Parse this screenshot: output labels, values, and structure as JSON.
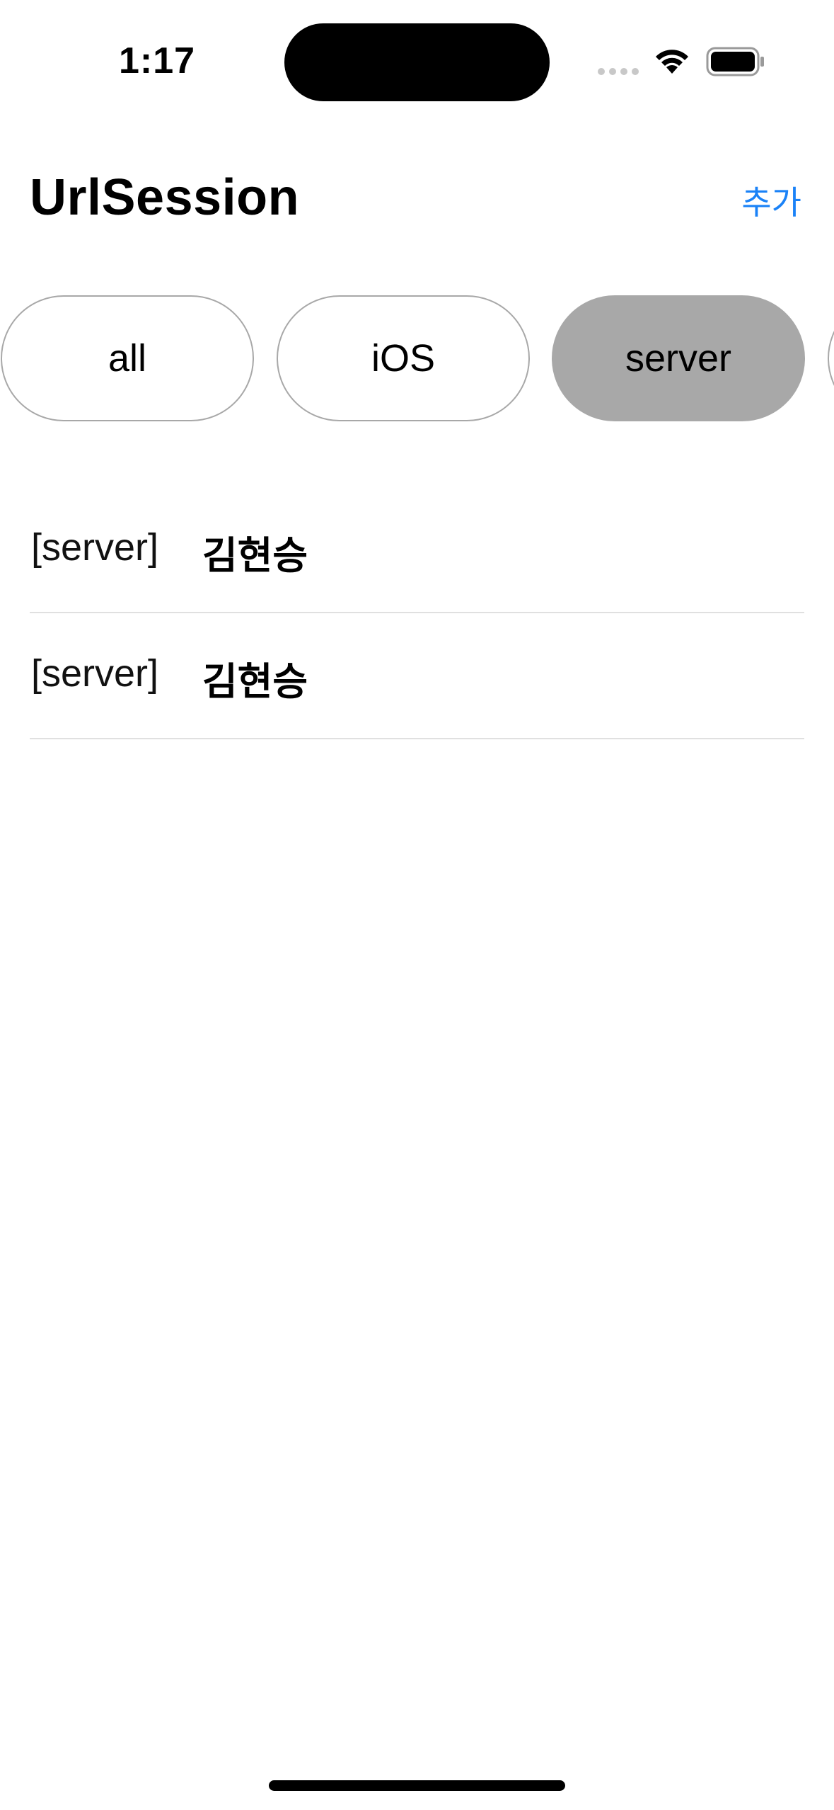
{
  "status_bar": {
    "time": "1:17",
    "icons": [
      "signal-icon",
      "wifi-icon",
      "battery-icon"
    ]
  },
  "nav": {
    "title": "UrlSession",
    "add_label": "추가",
    "accent_color": "#1a82f7"
  },
  "categories": {
    "items": [
      {
        "label": "all",
        "selected": false
      },
      {
        "label": "iOS",
        "selected": false
      },
      {
        "label": "server",
        "selected": true
      },
      {
        "label": "",
        "selected": false
      }
    ],
    "selected_color": "#a8a8a8"
  },
  "list": {
    "rows": [
      {
        "tag": "[server]",
        "name": "김현승"
      },
      {
        "tag": "[server]",
        "name": "김현승"
      }
    ]
  }
}
